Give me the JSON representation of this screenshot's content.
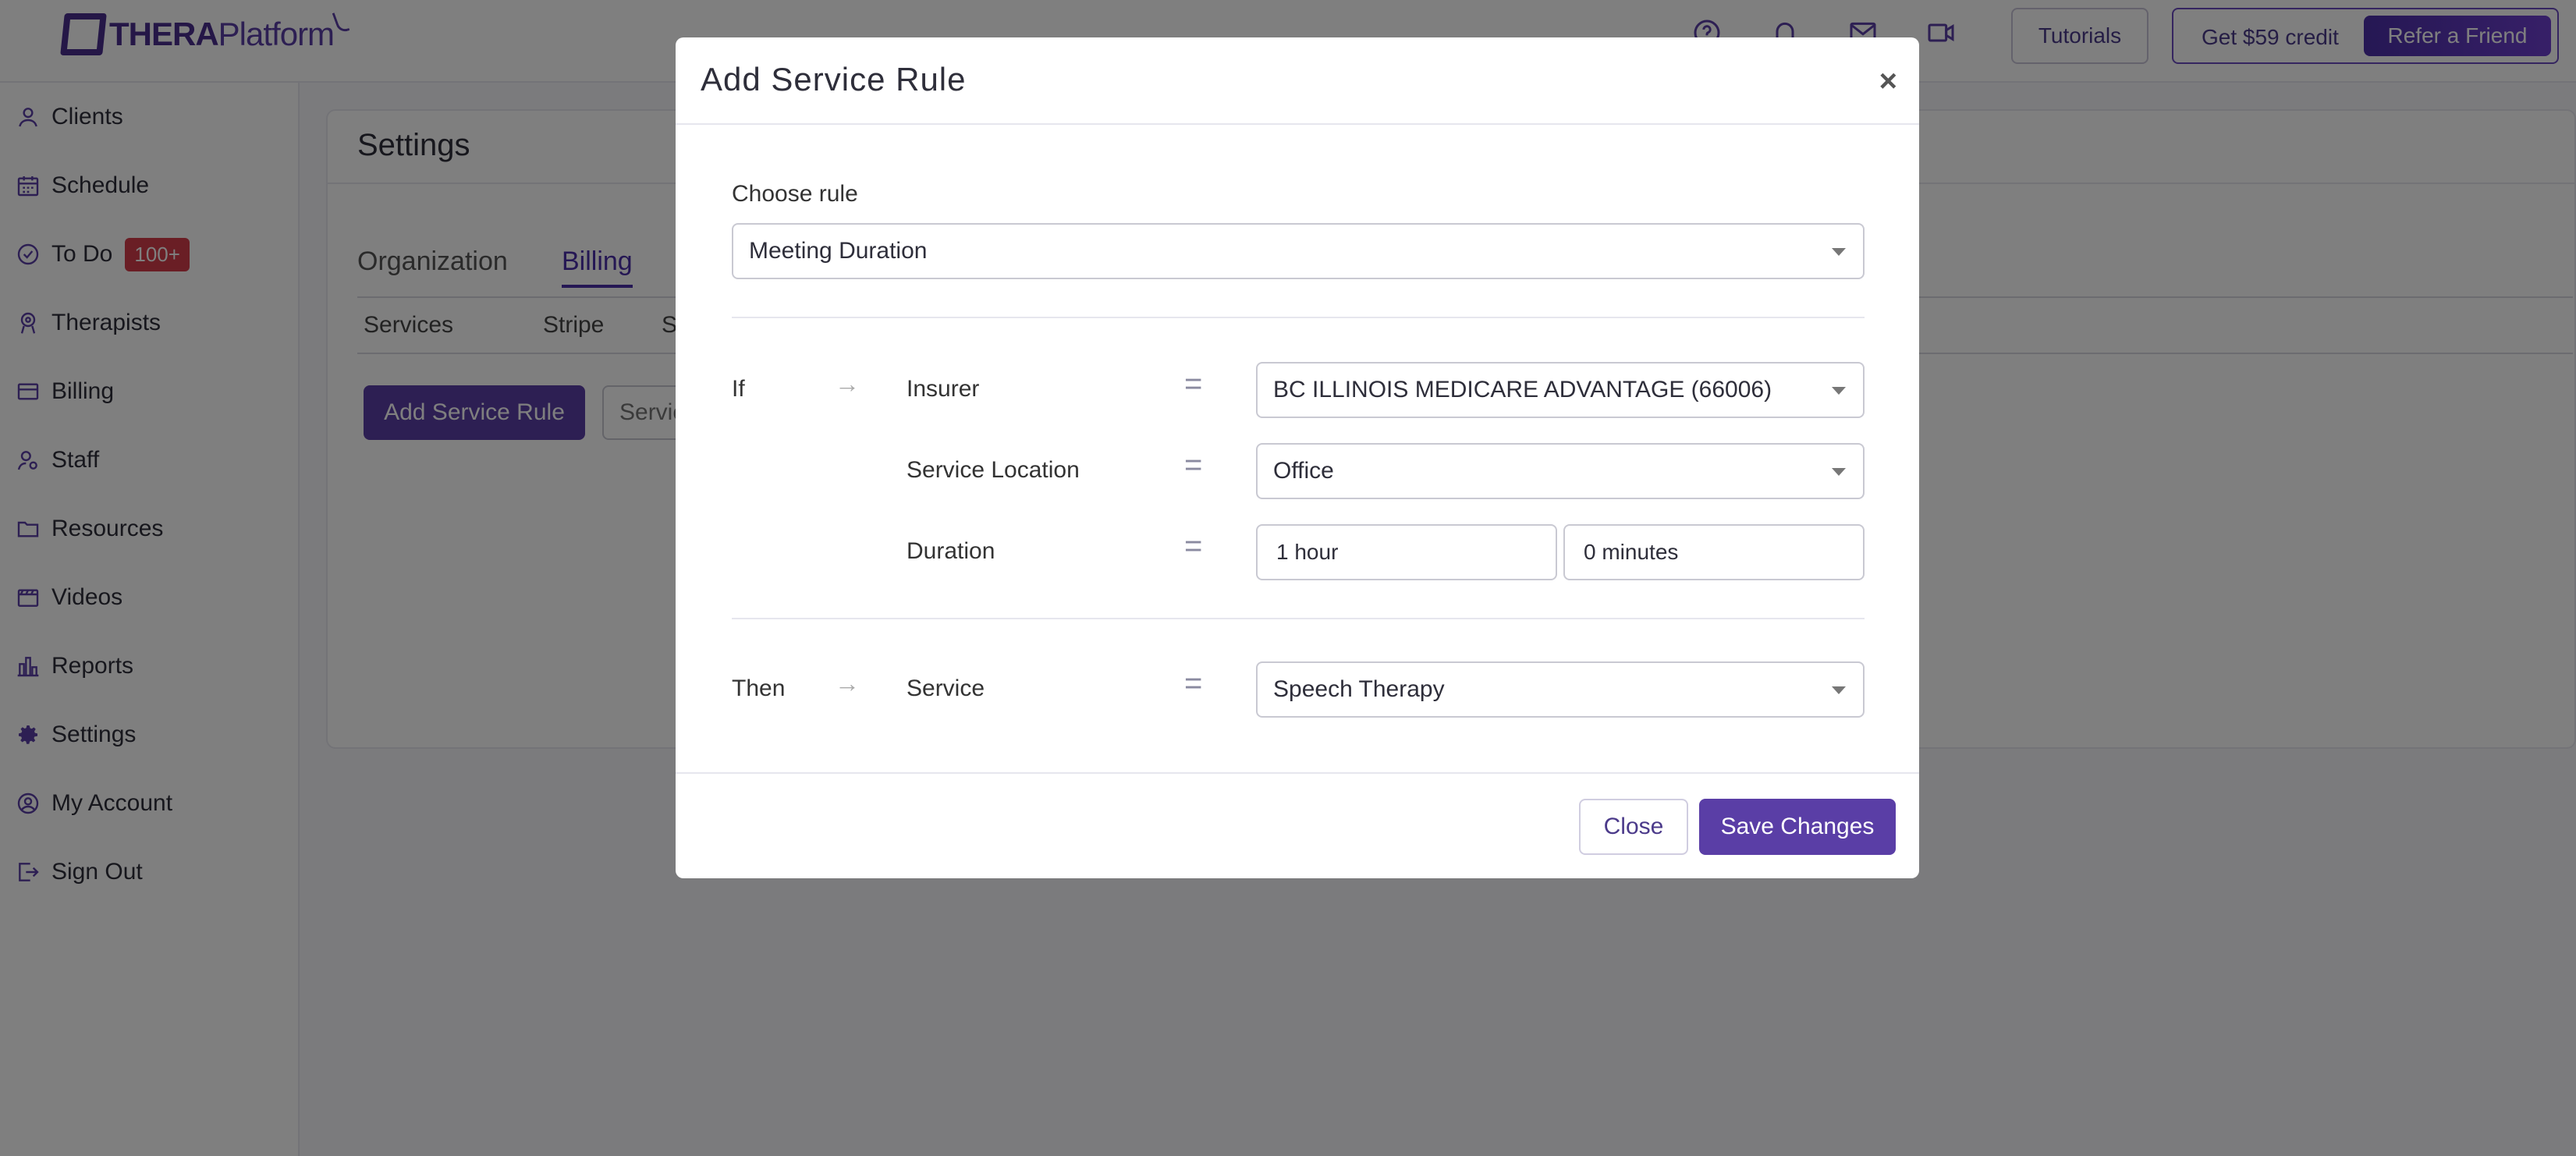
{
  "app": {
    "logo_bold": "THERA",
    "logo_light": "Platform"
  },
  "header": {
    "icons": [
      "help-icon",
      "bell-icon",
      "mail-icon",
      "video-icon"
    ],
    "tutorials_label": "Tutorials",
    "credit_label": "Get $59 credit",
    "refer_label": "Refer a Friend"
  },
  "sidebar": {
    "items": [
      {
        "label": "Clients",
        "icon": "user-icon"
      },
      {
        "label": "Schedule",
        "icon": "calendar-icon"
      },
      {
        "label": "To Do",
        "icon": "check-circle-icon",
        "badge": "100+"
      },
      {
        "label": "Therapists",
        "icon": "therapist-icon"
      },
      {
        "label": "Billing",
        "icon": "credit-card-icon"
      },
      {
        "label": "Staff",
        "icon": "staff-icon"
      },
      {
        "label": "Resources",
        "icon": "folder-icon"
      },
      {
        "label": "Videos",
        "icon": "film-icon"
      },
      {
        "label": "Reports",
        "icon": "bar-chart-icon"
      },
      {
        "label": "Settings",
        "icon": "gear-icon"
      },
      {
        "label": "My Account",
        "icon": "account-icon"
      },
      {
        "label": "Sign Out",
        "icon": "sign-out-icon"
      }
    ]
  },
  "settings": {
    "title": "Settings",
    "tabs": [
      {
        "label": "Organization",
        "active": false
      },
      {
        "label": "Billing",
        "active": true
      }
    ],
    "subtabs": [
      "Services",
      "Stripe",
      "Strip"
    ],
    "add_rule_label": "Add Service Rule",
    "search_placeholder": "Servic"
  },
  "modal": {
    "title": "Add Service Rule",
    "close_symbol": "×",
    "choose_rule_label": "Choose rule",
    "rule_value": "Meeting Duration",
    "if_label": "If",
    "then_label": "Then",
    "arrow": "→",
    "equals": "=",
    "conditions": [
      {
        "field": "Insurer",
        "value": "BC ILLINOIS MEDICARE ADVANTAGE (66006)"
      },
      {
        "field": "Service Location",
        "value": "Office"
      },
      {
        "field": "Duration",
        "hours": "1 hour",
        "minutes": "0 minutes"
      }
    ],
    "result": {
      "field": "Service",
      "value": "Speech Therapy"
    },
    "close_label": "Close",
    "save_label": "Save Changes"
  },
  "colors": {
    "brand": "#5a3ea6",
    "badge": "#d43c4a",
    "overlay": "rgba(0,0,0,0.5)"
  }
}
